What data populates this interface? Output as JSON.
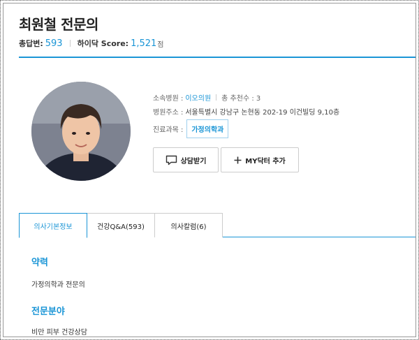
{
  "doctor": {
    "name_title": "최원철 전문의",
    "answers_label": "총답변:",
    "answers_count": "593",
    "score_label": "하이닥 Score:",
    "score_value": "1,521",
    "score_unit": "점"
  },
  "profile": {
    "hospital_label": "소속병원 :",
    "hospital_name": "이오의원",
    "recommend_label": "총 추천수 : 3",
    "address_label": "병원주소 :",
    "address_value": "서울특별시 강남구 논현동 202-19 이건빌딩 9,10층",
    "dept_label": "진료과목 :",
    "dept_tag": "가정의학과"
  },
  "buttons": {
    "consult": "상담받기",
    "add_my_doctor": "MY닥터 추가"
  },
  "tabs": [
    {
      "label": "의사기본정보"
    },
    {
      "label": "건강Q&A(593)"
    },
    {
      "label": "의사칼럼(6)"
    }
  ],
  "sections": {
    "career_title": "약력",
    "career_text": "가정의학과 전문의",
    "specialty_title": "전문분야",
    "specialty_text": "비만 피부 건강상담"
  },
  "colors": {
    "accent": "#1a95d6"
  }
}
